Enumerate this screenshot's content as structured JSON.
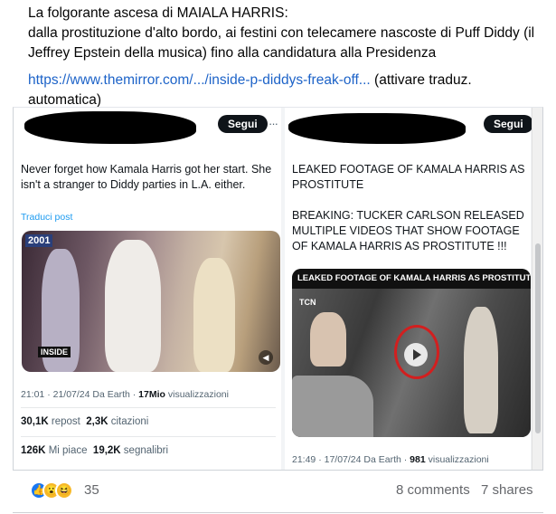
{
  "post": {
    "line1": "La folgorante ascesa di MAIALA HARRIS:",
    "line2": "dalla prostituzione d'alto bordo, ai festini con telecamere nascoste di Puff Diddy (il Jeffrey Epstein della musica) fino alla candidatura alla Presidenza",
    "link_text": "https://www.themirror.com/.../inside-p-diddys-freak-off...",
    "link_suffix": " (attivare traduz. automatica)"
  },
  "left_tweet": {
    "follow_label": "Segui",
    "more": "···",
    "text": "Never forget how Kamala Harris got her start. She isn't a stranger to Diddy parties in L.A. either.",
    "translate_label": "Traduci post",
    "media_sign": "2001",
    "media_watermark": "INSIDE",
    "time": "21:01 · 21/07/24 Da Earth · ",
    "views_count": "17Mio",
    "views_label": " visualizzazioni",
    "reposts_count": "30,1K",
    "reposts_label": " repost",
    "quotes_count": "2,3K",
    "quotes_label": " citazioni",
    "likes_count": "126K",
    "likes_label": " Mi piace",
    "bookmarks_count": "19,2K",
    "bookmarks_label": " segnalibri"
  },
  "right_tweet": {
    "follow_label": "Segui",
    "more": "···",
    "text1": "LEAKED FOOTAGE OF KAMALA HARRIS AS PROSTITUTE",
    "text2": "BREAKING:  TUCKER CARLSON RELEASED MULTIPLE VIDEOS THAT SHOW FOOTAGE OF KAMALA HARRIS AS PROSTITUTE !!!",
    "media_banner": "LEAKED FOOTAGE OF KAMALA HARRIS AS PROSTITUTE !!!",
    "media_logo": "TCN",
    "time": "21:49 · 17/07/24 Da Earth · ",
    "views_count": "981",
    "views_label": " visualizzazioni"
  },
  "footer": {
    "reaction_count": "35",
    "comments": "8 comments",
    "shares": "7 shares"
  },
  "colors": {
    "link": "#1d63c8",
    "like": "#1877f2",
    "emoji": "#f7b928",
    "circle": "#d21f1f"
  }
}
